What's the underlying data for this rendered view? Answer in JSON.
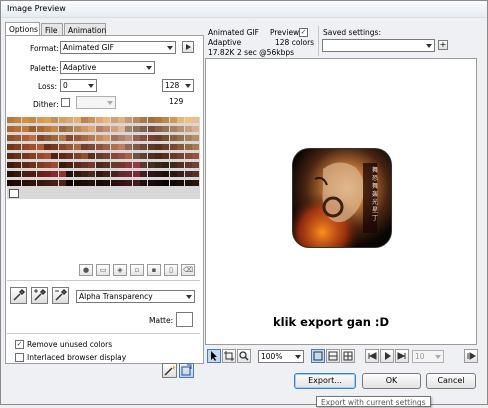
{
  "window": {
    "title": "Image Preview"
  },
  "tabs": [
    {
      "label": "Options"
    },
    {
      "label": "File"
    },
    {
      "label": "Animation"
    }
  ],
  "options": {
    "format_label": "Format:",
    "format_value": "Animated GIF",
    "palette_label": "Palette:",
    "palette_value": "Adaptive",
    "loss_label": "Loss:",
    "loss_value": "0",
    "colors_value": "128",
    "colors_count": "129",
    "dither_label": "Dither:",
    "transparency_value": "Alpha Transparency",
    "matte_label": "Matte:",
    "remove_unused_label": "Remove unused colors",
    "remove_unused_checked": true,
    "interlaced_label": "Interlaced browser display",
    "interlaced_checked": false
  },
  "preview_info": {
    "format": "Animated GIF",
    "palette": "Adaptive",
    "size": "17.82K",
    "time": "2 sec @56kbps",
    "preview_label": "Preview",
    "preview_checked": true,
    "colors": "128 colors"
  },
  "saved_settings": {
    "label": "Saved settings:",
    "value": ""
  },
  "preview_caption": "klik export gan :D",
  "image_text": "舞 恐 舞 轰 光 星 丁",
  "toolbar": {
    "zoom_value": "100%",
    "frame_value": "10"
  },
  "buttons": {
    "export": "Export...",
    "ok": "OK",
    "cancel": "Cancel"
  },
  "tooltip": "Export with current settings",
  "palette_colors": [
    "#b87a3c",
    "#c8843c",
    "#d0903c",
    "#c88848",
    "#d89850",
    "#e0a050",
    "#c89058",
    "#d8a060",
    "#e0a868",
    "#e8b070",
    "#c08050",
    "#d09058",
    "#e0a870",
    "#f0b878",
    "#d0a078",
    "#e0b080",
    "#c89870",
    "#b88858",
    "#a87848",
    "#a07040",
    "#b07840",
    "#c08848",
    "#d09858",
    "#e8b878",
    "#f0c080",
    "#e8c090",
    "#a86830",
    "#b87038",
    "#c07840",
    "#985c30",
    "#a86838",
    "#b87840",
    "#c88848",
    "#986840",
    "#a87848",
    "#c08858",
    "#d09868",
    "#e0a878",
    "#b08060",
    "#c09070",
    "#d0a080",
    "#e0b898",
    "#a08070",
    "#907060",
    "#806050",
    "#705040",
    "#886048",
    "#987050",
    "#a88060",
    "#b89070",
    "#c8a080",
    "#d8b090",
    "#905028",
    "#a05830",
    "#b06038",
    "#c07040",
    "#804820",
    "#905830",
    "#a06838",
    "#b07848",
    "#884830",
    "#985838",
    "#a86840",
    "#b87850",
    "#c88858",
    "#d89868",
    "#a07058",
    "#b08068",
    "#c09078",
    "#986050",
    "#885040",
    "#784030",
    "#684028",
    "#785030",
    "#886040",
    "#987048",
    "#a88058",
    "#b89068",
    "#703818",
    "#804020",
    "#904828",
    "#a05030",
    "#b05830",
    "#683018",
    "#783820",
    "#884828",
    "#985830",
    "#a86840",
    "#704030",
    "#804838",
    "#905040",
    "#a06048",
    "#b07050",
    "#c08060",
    "#906858",
    "#805848",
    "#704838",
    "#603828",
    "#583020",
    "#684028",
    "#784830",
    "#885838",
    "#986840",
    "#a87850",
    "#582810",
    "#683018",
    "#783820",
    "#884020",
    "#984828",
    "#a85030",
    "#502010",
    "#602818",
    "#703020",
    "#804028",
    "#905030",
    "#583020",
    "#683828",
    "#784030",
    "#884838",
    "#985040",
    "#a86048",
    "#705040",
    "#604030",
    "#503020",
    "#482818",
    "#583020",
    "#683828",
    "#784030",
    "#884838",
    "#985040",
    "#401808",
    "#502010",
    "#602818",
    "#703018",
    "#803820",
    "#904028",
    "#a04830",
    "#381808",
    "#482010",
    "#582818",
    "#683020",
    "#783828",
    "#482818",
    "#583020",
    "#683828",
    "#783030",
    "#883838",
    "#983840",
    "#583830",
    "#483020",
    "#382818",
    "#302010",
    "#402818",
    "#503020",
    "#603828",
    "#704030",
    "#281008",
    "#381808",
    "#482010",
    "#581810",
    "#682018",
    "#782020",
    "#882828",
    "#983030",
    "#201008",
    "#301808",
    "#402010",
    "#502818",
    "#301810",
    "#402018",
    "#502020",
    "#602828",
    "#702830",
    "#802838",
    "#402020",
    "#301818",
    "#281410",
    "#201008",
    "#281810",
    "#382018",
    "#482820",
    "#583028",
    "#180804",
    "#200c06",
    "#281008",
    "#30140a",
    "#38180c",
    "#401c0e",
    "#482010",
    "#502412",
    "#100402",
    "#180804",
    "#200c06",
    "#281008",
    "#180808",
    "#200c0c",
    "#281010",
    "#301414",
    "#381818",
    "#401c1c",
    "#201010",
    "#180c0c",
    "#100808",
    "#080404",
    "#100806",
    "#180c08",
    "#20100a",
    "#28140c"
  ]
}
